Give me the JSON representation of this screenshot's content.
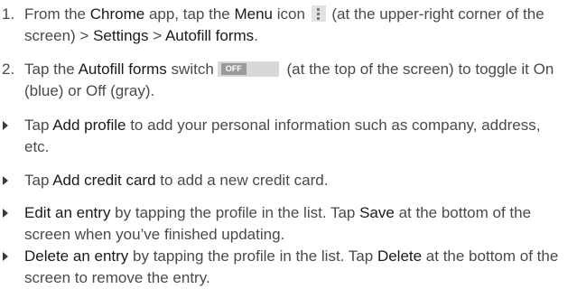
{
  "steps": [
    {
      "number": "1.",
      "p1": "From the ",
      "b1": "Chrome",
      "p2": " app, tap the ",
      "b2": "Menu",
      "p3": " icon",
      "p4": " (at the upper-right corner of the screen) > ",
      "b3": "Settings",
      "p5": " > ",
      "b4": "Autofill forms",
      "p6": "."
    },
    {
      "number": "2.",
      "p1": "Tap the ",
      "b1": "Autofill forms",
      "p2": " switch",
      "toggle_label": "OFF",
      "p3": " (at the top of the screen) to toggle it On (blue) or Off (gray)."
    }
  ],
  "bullets": [
    {
      "p1": "Tap ",
      "b1": "Add profile",
      "p2": " to add your personal information such as company, address, etc."
    },
    {
      "p1": "Tap ",
      "b1": "Add credit card",
      "p2": " to add a new credit card."
    },
    {
      "b1": "Edit an entry",
      "p1": " by tapping the profile in the list. Tap ",
      "b2": "Save",
      "p2": " at the bottom of the screen when you’ve finished updating."
    },
    {
      "b1": "Delete an entry",
      "p1": " by tapping the profile in the list. Tap ",
      "b2": "Delete",
      "p2": " at the bottom of the screen to remove the entry."
    }
  ]
}
